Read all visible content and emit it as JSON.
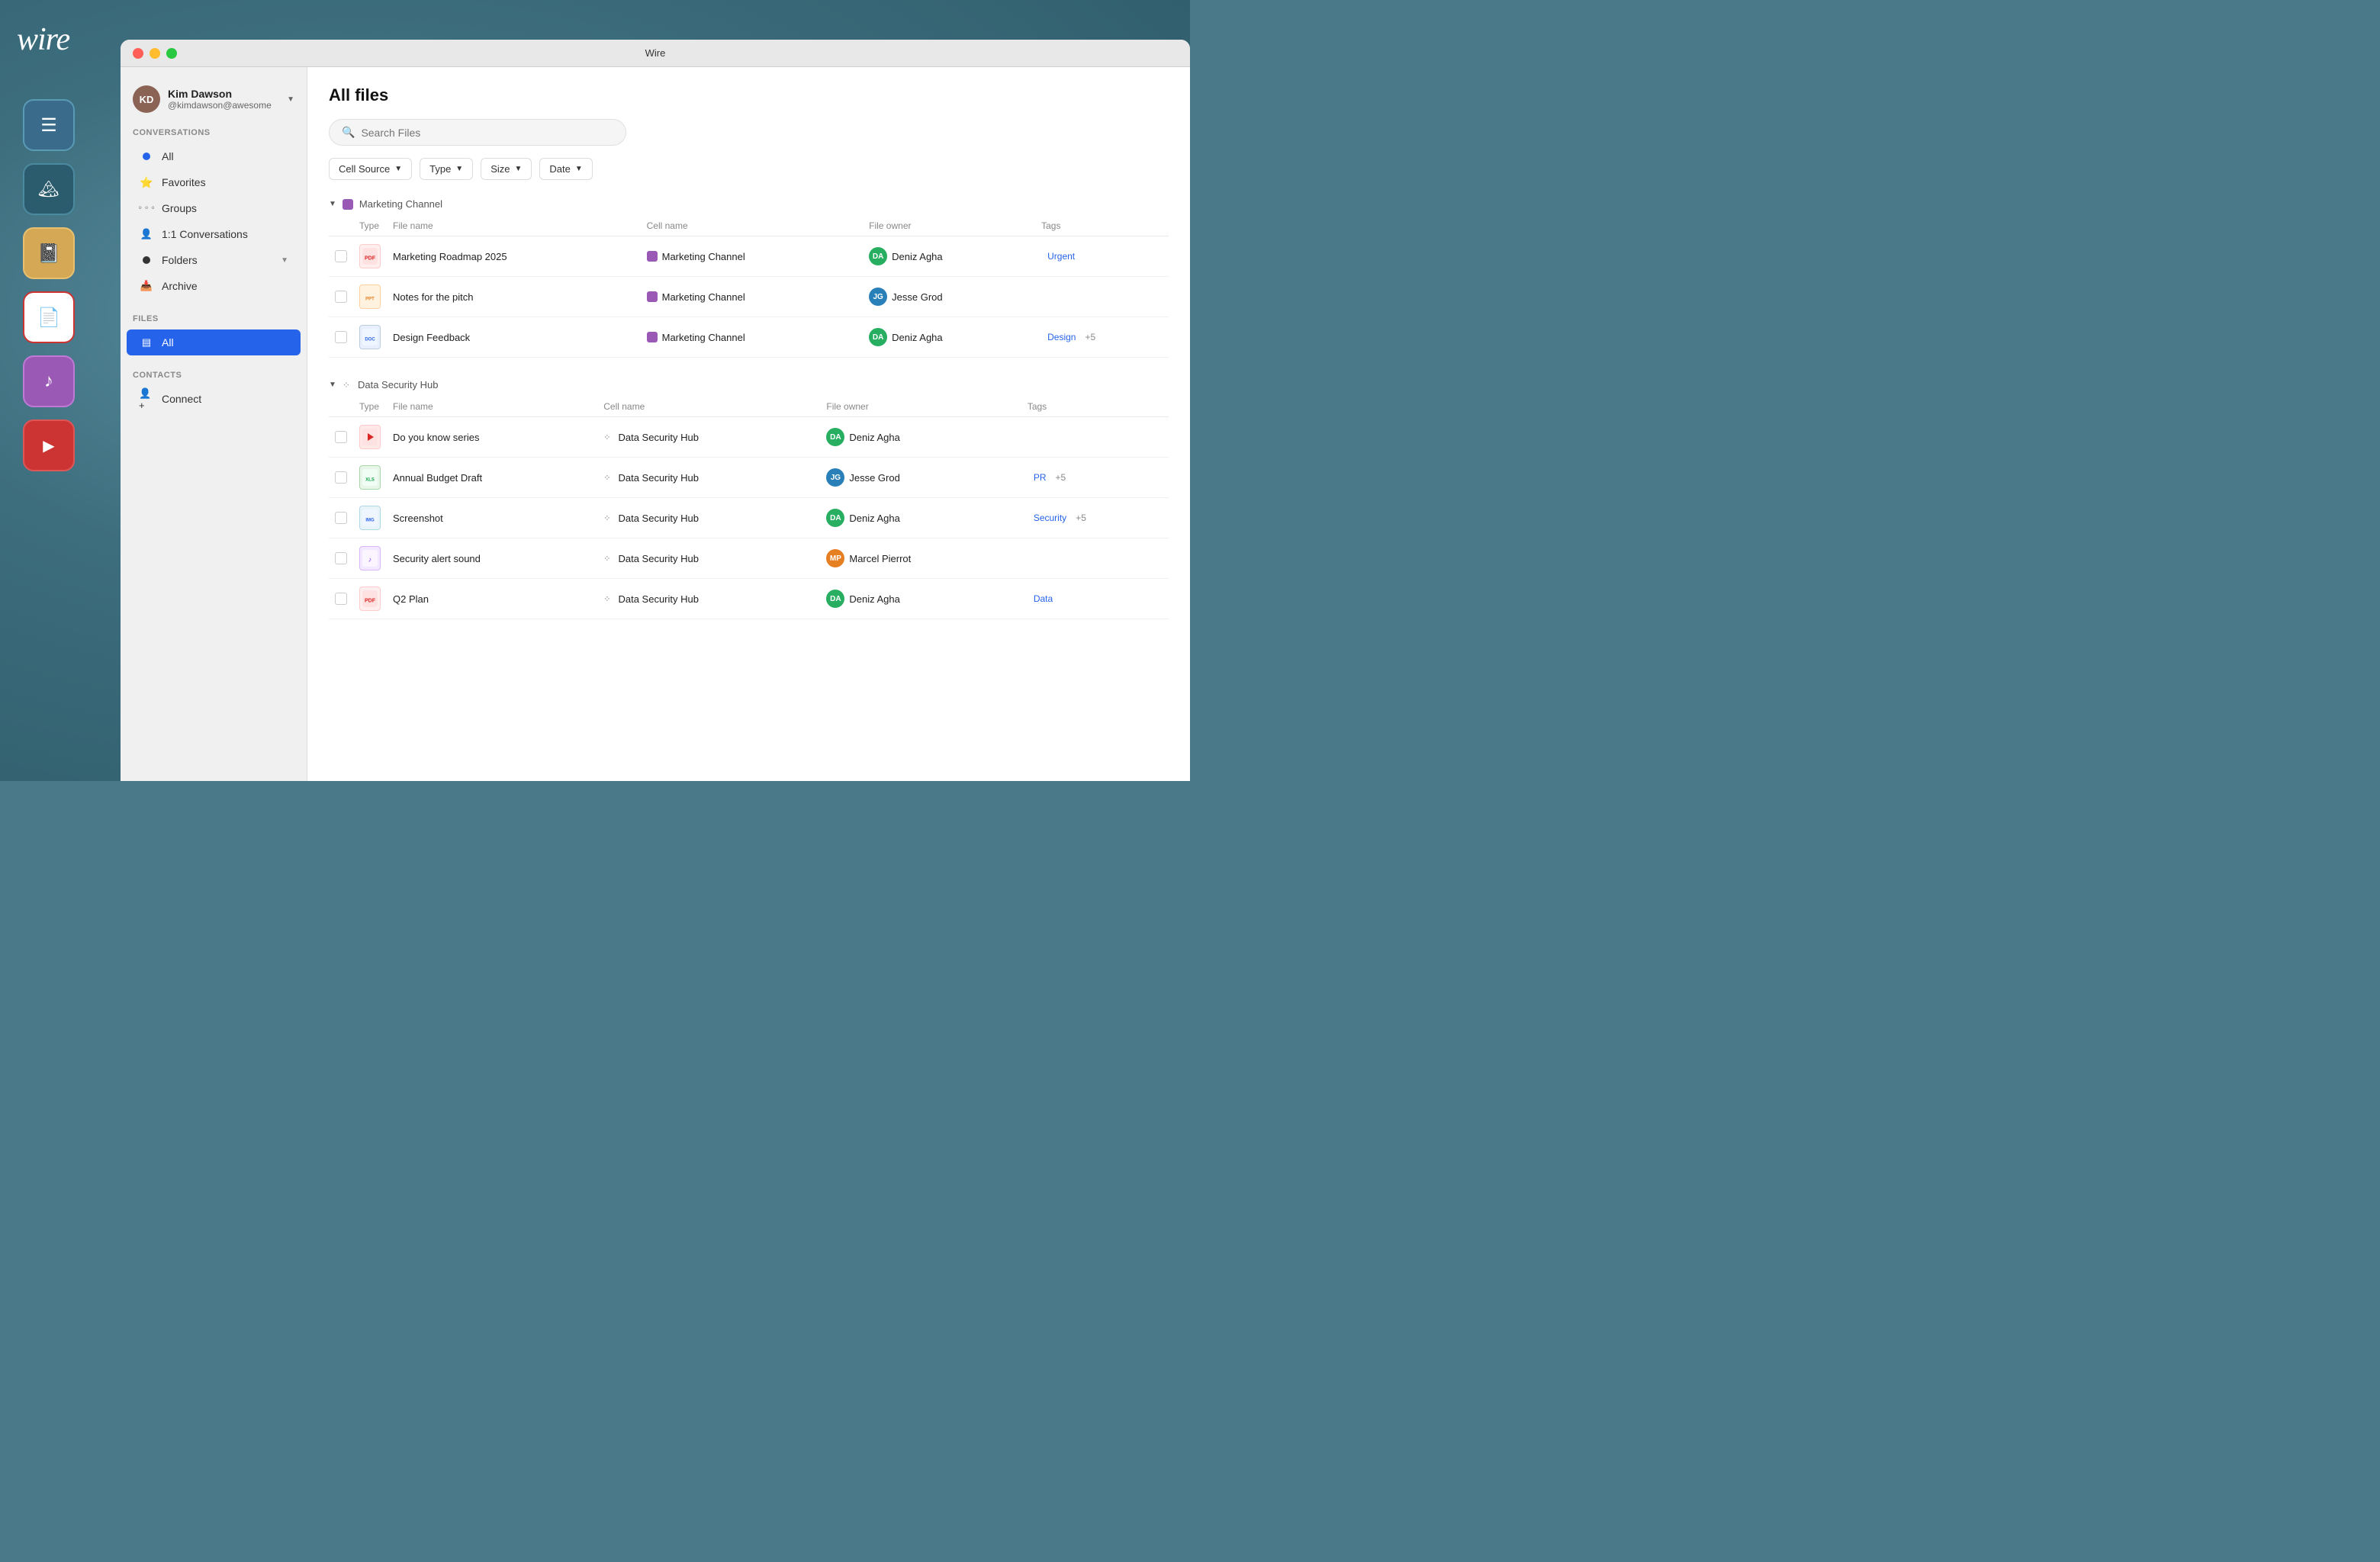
{
  "app": {
    "logo": "wire",
    "title": "Wire"
  },
  "background": {
    "color": "#4a7a8a"
  },
  "appIcons": [
    {
      "id": "notes",
      "label": "Notes App",
      "icon": "📋",
      "class": "app-icon-notes"
    },
    {
      "id": "image",
      "label": "Image App",
      "icon": "🖼",
      "class": "app-icon-image"
    },
    {
      "id": "notepad",
      "label": "Notepad App",
      "icon": "📓",
      "class": "app-icon-notepad"
    },
    {
      "id": "pdf",
      "label": "PDF App",
      "icon": "📄",
      "class": "app-icon-pdf"
    },
    {
      "id": "music",
      "label": "Music App",
      "icon": "🎵",
      "class": "app-icon-music"
    },
    {
      "id": "video",
      "label": "Video App",
      "icon": "▶",
      "class": "app-icon-video"
    }
  ],
  "titleBar": {
    "title": "Wire",
    "trafficLights": [
      "red",
      "yellow",
      "green"
    ]
  },
  "sidebar": {
    "user": {
      "name": "Kim Dawson",
      "handle": "@kimdawson@awesome",
      "avatarText": "KD"
    },
    "sections": {
      "conversations": {
        "label": "CONVERSATIONS",
        "items": [
          {
            "id": "all",
            "label": "All",
            "badge": "blue-dot"
          },
          {
            "id": "favorites",
            "label": "Favorites",
            "icon": "⭐"
          },
          {
            "id": "groups",
            "label": "Groups",
            "icon": "⚬⚬"
          },
          {
            "id": "1on1",
            "label": "1:1 Conversations",
            "icon": "👤"
          },
          {
            "id": "folders",
            "label": "Folders",
            "hasChevron": true
          },
          {
            "id": "archive",
            "label": "Archive",
            "icon": "📥"
          }
        ]
      },
      "files": {
        "label": "FILES",
        "items": [
          {
            "id": "all-files",
            "label": "All",
            "active": true
          }
        ]
      },
      "contacts": {
        "label": "CONTACTS",
        "items": [
          {
            "id": "connect",
            "label": "Connect"
          }
        ]
      }
    }
  },
  "mainContent": {
    "pageTitle": "All files",
    "search": {
      "placeholder": "Search Files"
    },
    "filters": [
      {
        "id": "cell-source",
        "label": "Cell Source"
      },
      {
        "id": "type",
        "label": "Type"
      },
      {
        "id": "size",
        "label": "Size"
      },
      {
        "id": "date",
        "label": "Date"
      }
    ],
    "groups": [
      {
        "id": "marketing",
        "name": "Marketing Channel",
        "color": "#9b59b6",
        "colorClass": "purple",
        "columns": [
          "Type",
          "File name",
          "Cell name",
          "File owner",
          "Tags"
        ],
        "files": [
          {
            "id": "file-1",
            "typeIcon": "PDF",
            "typeClass": "ft-pdf",
            "fileName": "Marketing Roadmap 2025",
            "cellName": "Marketing Channel",
            "cellColor": "#9b59b6",
            "fileOwner": "Deniz Agha",
            "ownerColor": "#27ae60",
            "tags": [
              {
                "label": "Urgent",
                "class": "tag-urgent"
              }
            ],
            "extraTags": 0
          },
          {
            "id": "file-2",
            "typeIcon": "PPT",
            "typeClass": "ft-ppt",
            "fileName": "Notes for the pitch",
            "cellName": "Marketing Channel",
            "cellColor": "#9b59b6",
            "fileOwner": "Jesse Grod",
            "ownerColor": "#2980b9",
            "tags": [],
            "extraTags": 0
          },
          {
            "id": "file-3",
            "typeIcon": "DOC",
            "typeClass": "ft-doc",
            "fileName": "Design Feedback",
            "cellName": "Marketing Channel",
            "cellColor": "#9b59b6",
            "fileOwner": "Deniz Agha",
            "ownerColor": "#27ae60",
            "tags": [
              {
                "label": "Design",
                "class": "tag-design"
              }
            ],
            "extraTags": 5
          }
        ]
      },
      {
        "id": "security",
        "name": "Data Security Hub",
        "color": "#666",
        "colorClass": "hub",
        "columns": [
          "Type",
          "File name",
          "Cell name",
          "File owner",
          "Tags"
        ],
        "files": [
          {
            "id": "file-4",
            "typeIcon": "VID",
            "typeClass": "ft-video",
            "fileName": "Do you know series",
            "cellName": "Data Security Hub",
            "isHub": true,
            "fileOwner": "Deniz Agha",
            "ownerColor": "#27ae60",
            "tags": [],
            "extraTags": 0
          },
          {
            "id": "file-5",
            "typeIcon": "XLS",
            "typeClass": "ft-excel",
            "fileName": "Annual Budget Draft",
            "cellName": "Data Security Hub",
            "isHub": true,
            "fileOwner": "Jesse Grod",
            "ownerColor": "#2980b9",
            "tags": [
              {
                "label": "PR",
                "class": "tag-pr"
              }
            ],
            "extraTags": 5
          },
          {
            "id": "file-6",
            "typeIcon": "IMG",
            "typeClass": "ft-img",
            "fileName": "Screenshot",
            "cellName": "Data Security Hub",
            "isHub": true,
            "fileOwner": "Deniz Agha",
            "ownerColor": "#27ae60",
            "tags": [
              {
                "label": "Security",
                "class": "tag-security"
              }
            ],
            "extraTags": 5
          },
          {
            "id": "file-7",
            "typeIcon": "AUD",
            "typeClass": "ft-audio",
            "fileName": "Security alert sound",
            "cellName": "Data Security Hub",
            "isHub": true,
            "fileOwner": "Marcel Pierrot",
            "ownerColor": "#e67e22",
            "tags": [],
            "extraTags": 0
          },
          {
            "id": "file-8",
            "typeIcon": "PDF",
            "typeClass": "ft-pdf",
            "fileName": "Q2 Plan",
            "cellName": "Data Security Hub",
            "isHub": true,
            "fileOwner": "Deniz Agha",
            "ownerColor": "#27ae60",
            "tags": [
              {
                "label": "Data",
                "class": "tag-data"
              }
            ],
            "extraTags": 0
          }
        ]
      }
    ]
  }
}
